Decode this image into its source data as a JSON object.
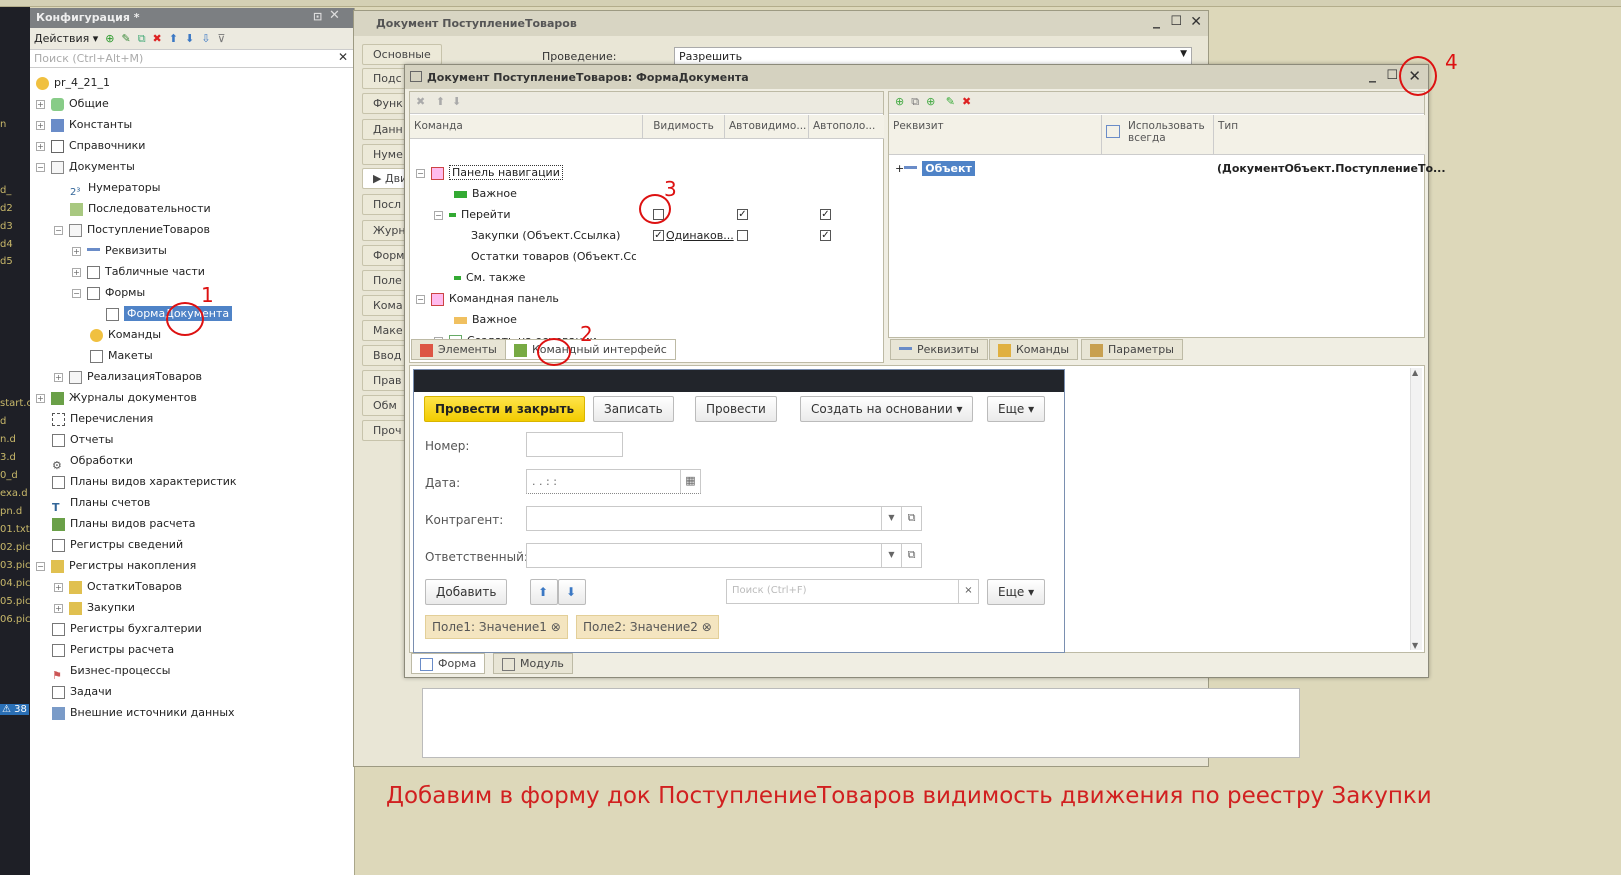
{
  "config": {
    "title": "Конфигурация *",
    "actions": "Действия",
    "search_placeholder": "Поиск (Ctrl+Alt+M)",
    "tree": [
      {
        "label": "pr_4_21_1",
        "icon": "database-icon"
      },
      {
        "label": "Общие",
        "icon": "common-icon"
      },
      {
        "label": "Константы",
        "icon": "constants-icon"
      },
      {
        "label": "Справочники",
        "icon": "catalogs-icon"
      },
      {
        "label": "Документы",
        "icon": "documents-icon"
      },
      {
        "label": "Нумераторы",
        "icon": "numerators-icon"
      },
      {
        "label": "Последовательности",
        "icon": "sequences-icon"
      },
      {
        "label": "ПоступлениеТоваров",
        "icon": "document-icon"
      },
      {
        "label": "Реквизиты",
        "icon": "attributes-icon"
      },
      {
        "label": "Табличные части",
        "icon": "table-icon"
      },
      {
        "label": "Формы",
        "icon": "forms-icon"
      },
      {
        "label": "ФормаДокумента",
        "icon": "form-icon"
      },
      {
        "label": "Команды",
        "icon": "commands-icon"
      },
      {
        "label": "Макеты",
        "icon": "templates-icon"
      },
      {
        "label": "РеализацияТоваров",
        "icon": "document-icon"
      },
      {
        "label": "Журналы документов",
        "icon": "journals-icon"
      },
      {
        "label": "Перечисления",
        "icon": "enums-icon"
      },
      {
        "label": "Отчеты",
        "icon": "reports-icon"
      },
      {
        "label": "Обработки",
        "icon": "processing-icon"
      },
      {
        "label": "Планы видов характеристик",
        "icon": "chart-types-icon"
      },
      {
        "label": "Планы счетов",
        "icon": "accounts-icon"
      },
      {
        "label": "Планы видов расчета",
        "icon": "calc-types-icon"
      },
      {
        "label": "Регистры сведений",
        "icon": "info-registers-icon"
      },
      {
        "label": "Регистры накопления",
        "icon": "accum-registers-icon"
      },
      {
        "label": "ОстаткиТоваров",
        "icon": "register-icon"
      },
      {
        "label": "Закупки",
        "icon": "register-icon"
      },
      {
        "label": "Регистры бухгалтерии",
        "icon": "accounting-registers-icon"
      },
      {
        "label": "Регистры расчета",
        "icon": "calc-registers-icon"
      },
      {
        "label": "Бизнес-процессы",
        "icon": "business-process-icon"
      },
      {
        "label": "Задачи",
        "icon": "tasks-icon"
      },
      {
        "label": "Внешние источники данных",
        "icon": "external-data-icon"
      }
    ]
  },
  "leftstrip": [
    "n",
    "d_",
    "d2",
    "d3",
    "d4",
    "d5",
    "start.c",
    "d",
    "n.d",
    "3.d",
    "0_d",
    "exa.d",
    "pn.d",
    "01.txt",
    "02.pic",
    "03.pic",
    "04.pic",
    "05.pic",
    "06.pic",
    "⚠ 38"
  ],
  "doc": {
    "title": "Документ ПоступлениеТоваров",
    "tabs": [
      "Основные",
      "Подс",
      "Функ",
      "Данн",
      "Нуме",
      "Движ",
      "Посл",
      "Журн",
      "Форм",
      "Поле",
      "Кома",
      "Маке",
      "Ввод",
      "Прав",
      "Обм",
      "Проч"
    ],
    "posting_label": "Проведение:",
    "posting_value": "Разрешить"
  },
  "form": {
    "title": "Документ ПоступлениеТоваров: ФормаДокумента",
    "cmd_headers": [
      "Команда",
      "Видимость",
      "Автовидимо...",
      "Автополо..."
    ],
    "cmd_rows": [
      "Панель навигации",
      "Важное",
      "Перейти",
      "Закупки (Объект.Ссылка)",
      "Остатки товаров (Объект.Ссы...",
      "См. также",
      "Командная панель",
      "Важное",
      "Создать на основании"
    ],
    "same_label": "Одинаков...",
    "left_tabs": [
      "Элементы",
      "Командный интерфейс"
    ],
    "attr_headers": [
      "Реквизит",
      "Использовать всегда",
      "Тип"
    ],
    "attr_object": "Объект",
    "attr_type": "(ДокументОбъект.ПоступлениеТо...",
    "right_tabs": [
      "Реквизиты",
      "Команды",
      "Параметры"
    ],
    "bottom_tabs": [
      "Форма",
      "Модуль"
    ]
  },
  "preview": {
    "btn_post_close": "Провести и закрыть",
    "btn_save": "Записать",
    "btn_post": "Провести",
    "btn_create": "Создать на основании",
    "btn_more": "Еще",
    "lbl_number": "Номер:",
    "lbl_date": "Дата:",
    "date_value": " .  .      : :",
    "lbl_contractor": "Контрагент:",
    "lbl_responsible": "Ответственный:",
    "btn_add": "Добавить",
    "search_placeholder": "Поиск (Ctrl+F)",
    "chip1": "Поле1: Значение1",
    "chip2": "Поле2: Значение2"
  },
  "annotations": [
    "1",
    "2",
    "3",
    "4"
  ],
  "caption": "Добавим в форму док ПоступлениеТоваров видимость движения по реестру Закупки"
}
